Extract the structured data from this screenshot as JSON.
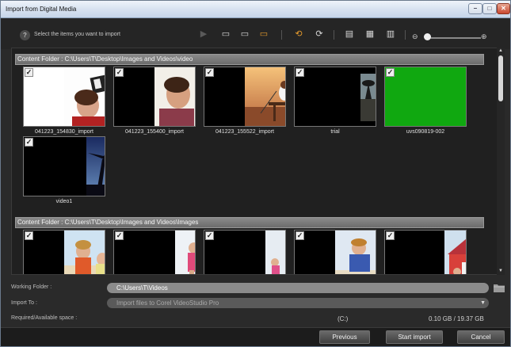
{
  "window": {
    "title": "Import from Digital Media",
    "controls": {
      "minimize": "–",
      "maximize": "□",
      "close": "✕"
    }
  },
  "toolbar": {
    "help_icon": "?",
    "instruction": "Select the items you want to import",
    "tools": [
      {
        "icon": "play-icon",
        "glyph": "▶"
      },
      {
        "icon": "select-all-icon",
        "glyph": "▭"
      },
      {
        "icon": "select-none-icon",
        "glyph": "▭"
      },
      {
        "icon": "select-checked-icon",
        "glyph": "▭"
      },
      {
        "icon": "rotate-left-icon",
        "glyph": "⟲"
      },
      {
        "icon": "rotate-right-icon",
        "glyph": "⟳"
      },
      {
        "icon": "detail-view-icon",
        "glyph": "▤"
      },
      {
        "icon": "thumbnail-view-icon",
        "glyph": "▦"
      },
      {
        "icon": "file-info-icon",
        "glyph": "▥"
      }
    ],
    "zoom_out_icon": "⊖",
    "zoom_in_icon": "⊕",
    "zoom_level": 0.05
  },
  "sections": [
    {
      "header": "Content Folder : C:\\Users\\T\\Desktop\\Images and Videos\\video",
      "items": [
        {
          "caption": "041223_154830_import",
          "checked": true
        },
        {
          "caption": "041223_155400_import",
          "checked": true
        },
        {
          "caption": "041223_155522_import",
          "checked": true
        },
        {
          "caption": "trial",
          "checked": true
        },
        {
          "caption": "uvs090819-002",
          "checked": true
        },
        {
          "caption": "video1",
          "checked": true
        }
      ]
    },
    {
      "header": "Content Folder : C:\\Users\\T\\Desktop\\Images and Videos\\Images",
      "items": [
        {
          "caption": "",
          "checked": true
        },
        {
          "caption": "",
          "checked": true
        },
        {
          "caption": "",
          "checked": true
        },
        {
          "caption": "",
          "checked": true
        },
        {
          "caption": "",
          "checked": true
        }
      ]
    }
  ],
  "check_glyph": "✓",
  "settings": {
    "working_folder_label": "Working Folder :",
    "working_folder_value": "C:\\Users\\T\\Videos",
    "import_to_label": "Import To :",
    "import_to_value": "Import files to Corel VideoStudio Pro",
    "space_label": "Required/Available space :",
    "drive": "(C:)",
    "space_value": "0.10 GB / 19.37 GB",
    "dropdown_glyph": "▼"
  },
  "buttons": {
    "previous": "Previous",
    "start_import": "Start import",
    "cancel": "Cancel"
  },
  "colors": {
    "accent_green": "#10a810",
    "folder_icon": "#9a9a9a"
  }
}
